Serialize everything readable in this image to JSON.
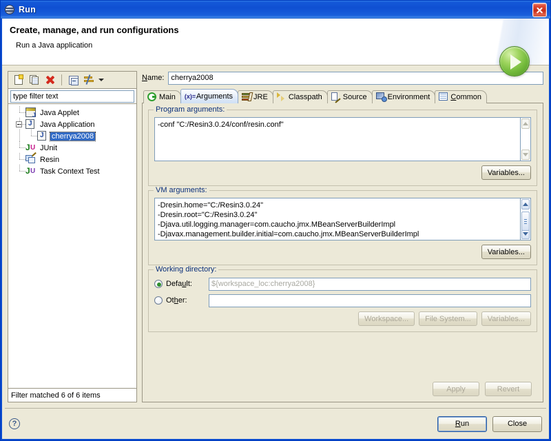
{
  "window": {
    "title": "Run",
    "icon": "eclipse-globe-icon",
    "close_label": "close-icon"
  },
  "banner": {
    "title": "Create, manage, and run configurations",
    "subtitle": "Run a Java application",
    "art_icon": "green-run-play-icon"
  },
  "toolbar": {
    "items": [
      {
        "name": "new-launch-configuration",
        "icon": "new-page-icon"
      },
      {
        "name": "duplicate-launch-configuration",
        "icon": "duplicate-icon"
      },
      {
        "name": "delete-launch-configuration",
        "icon": "delete-red-x-icon"
      },
      {
        "name": "collapse-all",
        "icon": "collapse-all-icon"
      },
      {
        "name": "filter-configurations",
        "icon": "filter-icon"
      }
    ]
  },
  "filter": {
    "value": "type filter text",
    "status": "Filter matched 6 of 6 items"
  },
  "tree": {
    "items": [
      {
        "label": "Java Applet",
        "icon": "java-applet-icon",
        "level": 0,
        "selected": false,
        "expandable": false
      },
      {
        "label": "Java Application",
        "icon": "java-application-icon",
        "level": 0,
        "selected": false,
        "expandable": true,
        "expanded": true
      },
      {
        "label": "cherrya2008",
        "icon": "java-application-icon",
        "level": 1,
        "selected": true,
        "expandable": false
      },
      {
        "label": "JUnit",
        "icon": "junit-icon",
        "level": 0,
        "selected": false,
        "expandable": false
      },
      {
        "label": "Resin",
        "icon": "resin-icon",
        "level": 0,
        "selected": false,
        "expandable": false
      },
      {
        "label": "Task Context Test",
        "icon": "junit-purple-icon",
        "level": 0,
        "selected": false,
        "expandable": false
      }
    ]
  },
  "name_field": {
    "label": "Name:",
    "value": "cherrya2008"
  },
  "tabs": [
    {
      "label": "Main",
      "icon": "main-green-circle-icon",
      "active": false
    },
    {
      "label": "Arguments",
      "icon": "arguments-variable-icon",
      "active": true
    },
    {
      "label": "JRE",
      "icon": "jre-books-icon",
      "active": false
    },
    {
      "label": "Classpath",
      "icon": "classpath-arrows-icon",
      "active": false
    },
    {
      "label": "Source",
      "icon": "source-pencil-icon",
      "active": false
    },
    {
      "label": "Environment",
      "icon": "environment-monitor-icon",
      "active": false
    },
    {
      "label": "Common",
      "icon": "common-list-icon",
      "active": false
    }
  ],
  "program_arguments": {
    "legend": "Program arguments:",
    "value": "-conf \"C:/Resin3.0.24/conf/resin.conf\"",
    "variables_button": "Variables...",
    "scrollbar_enabled": false
  },
  "vm_arguments": {
    "legend": "VM arguments:",
    "value": "-Dresin.home=\"C:/Resin3.0.24\"\n-Dresin.root=\"C:/Resin3.0.24\"\n-Djava.util.logging.manager=com.caucho.jmx.MBeanServerBuilderImpl\n-Djavax.management.builder.initial=com.caucho.jmx.MBeanServerBuilderImpl",
    "variables_button": "Variables...",
    "scrollbar_enabled": true
  },
  "working_directory": {
    "legend": "Working directory:",
    "default_label": "Default:",
    "default_selected": true,
    "default_value": "${workspace_loc:cherrya2008}",
    "other_label": "Other:",
    "other_selected": false,
    "other_value": "",
    "buttons": [
      {
        "label": "Workspace...",
        "enabled": false
      },
      {
        "label": "File System...",
        "enabled": false
      },
      {
        "label": "Variables...",
        "enabled": false
      }
    ]
  },
  "apply_bar": {
    "apply": "Apply",
    "apply_enabled": false,
    "revert": "Revert",
    "revert_enabled": false
  },
  "footer": {
    "help_icon": "help-question-icon",
    "run": "Run",
    "close": "Close"
  },
  "colors": {
    "titlebar_blue": "#0f4fd2",
    "dialog_bg": "#ece9d8",
    "selection_blue": "#316ac5",
    "group_legend": "#0a2f7a",
    "close_red": "#c62d18",
    "run_green": "#72b93a"
  }
}
